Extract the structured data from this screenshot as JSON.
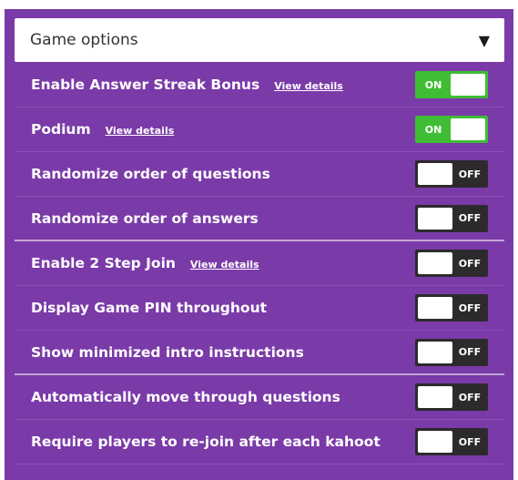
{
  "header": {
    "title": "Game options"
  },
  "options": [
    {
      "label": "Enable Answer Streak Bonus",
      "link": "View details",
      "state": "ON"
    },
    {
      "label": "Podium",
      "link": "View details",
      "state": "ON"
    },
    {
      "label": "Randomize order of questions",
      "link": "",
      "state": "OFF"
    },
    {
      "label": "Randomize order of answers",
      "link": "",
      "state": "OFF"
    },
    {
      "label": "Enable 2 Step Join",
      "link": "View details",
      "state": "OFF"
    },
    {
      "label": "Display Game PIN throughout",
      "link": "",
      "state": "OFF"
    },
    {
      "label": "Show minimized intro instructions",
      "link": "",
      "state": "OFF"
    },
    {
      "label": "Automatically move through questions",
      "link": "",
      "state": "OFF"
    },
    {
      "label": "Require players to re-join after each kahoot",
      "link": "",
      "state": "OFF"
    }
  ],
  "colors": {
    "panel": "#7a3aa8",
    "toggle_on": "#3fbd34",
    "toggle_off": "#2d2a2e"
  }
}
